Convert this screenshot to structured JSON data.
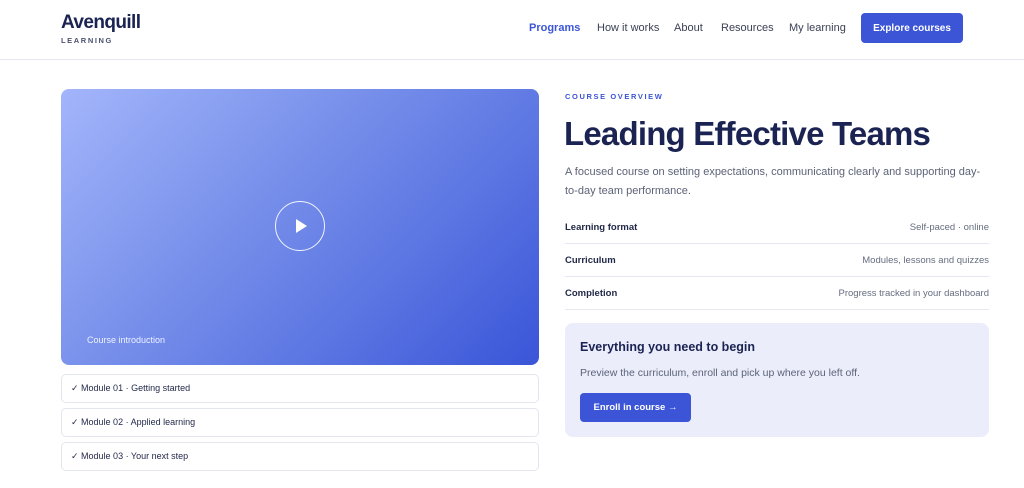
{
  "brand": {
    "name": "Avenquill",
    "tagline": "LEARNING"
  },
  "nav": {
    "items": [
      {
        "label": "Programs",
        "active": true
      },
      {
        "label": "How it works",
        "active": false
      },
      {
        "label": "About",
        "active": false
      },
      {
        "label": "Resources",
        "active": false
      },
      {
        "label": "My learning",
        "active": false
      }
    ],
    "cta_label": "Explore courses"
  },
  "video": {
    "caption": "Course introduction",
    "play_icon": "play-icon"
  },
  "modules": [
    {
      "label": "✓ Module 01 · Getting started"
    },
    {
      "label": "✓ Module 02 · Applied learning"
    },
    {
      "label": "✓ Module 03 · Your next step"
    }
  ],
  "course": {
    "eyebrow": "COURSE OVERVIEW",
    "title": "Leading Effective Teams",
    "description": "A focused course on setting expectations, communicating clearly and supporting day-to-day team performance.",
    "details": [
      {
        "label": "Learning format",
        "value": "Self-paced · online"
      },
      {
        "label": "Curriculum",
        "value": "Modules, lessons and quizzes"
      },
      {
        "label": "Completion",
        "value": "Progress tracked in your dashboard"
      }
    ]
  },
  "start_card": {
    "title": "Everything you need to begin",
    "text": "Preview the curriculum, enroll and pick up where you left off.",
    "button_label": "Enroll in course →"
  },
  "colors": {
    "accent": "#3b55d6",
    "heading": "#1a2352",
    "card_bg": "#ebedfb"
  }
}
